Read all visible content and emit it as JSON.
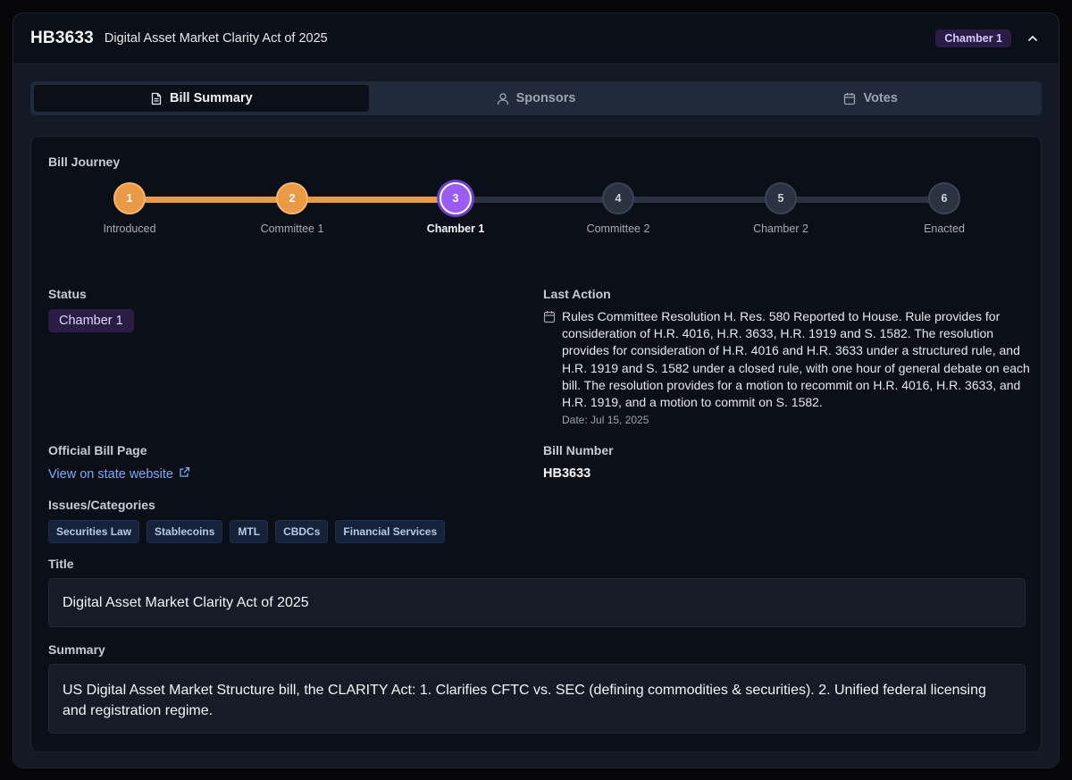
{
  "header": {
    "bill_id": "HB3633",
    "title": "Digital Asset Market Clarity Act of 2025",
    "badge": "Chamber 1"
  },
  "tabs": [
    {
      "label": "Bill Summary",
      "icon": "document-icon",
      "active": true
    },
    {
      "label": "Sponsors",
      "icon": "user-icon",
      "active": false
    },
    {
      "label": "Votes",
      "icon": "calendar-icon",
      "active": false
    }
  ],
  "journey": {
    "label": "Bill Journey",
    "current_step": 3,
    "steps": [
      {
        "number": "1",
        "label": "Introduced",
        "state": "done"
      },
      {
        "number": "2",
        "label": "Committee 1",
        "state": "done"
      },
      {
        "number": "3",
        "label": "Chamber 1",
        "state": "current"
      },
      {
        "number": "4",
        "label": "Committee 2",
        "state": "todo"
      },
      {
        "number": "5",
        "label": "Chamber 2",
        "state": "todo"
      },
      {
        "number": "6",
        "label": "Enacted",
        "state": "todo"
      }
    ]
  },
  "status": {
    "label": "Status",
    "value": "Chamber 1"
  },
  "last_action": {
    "label": "Last Action",
    "text": "Rules Committee Resolution H. Res. 580 Reported to House. Rule provides for consideration of H.R. 4016, H.R. 3633, H.R. 1919 and S. 1582. The resolution provides for consideration of H.R. 4016 and H.R. 3633 under a structured rule, and H.R. 1919 and S. 1582 under a closed rule, with one hour of general debate on each bill. The resolution provides for a motion to recommit on H.R. 4016, H.R. 3633, and H.R. 1919, and a motion to commit on S. 1582.",
    "date": "Date: Jul 15, 2025"
  },
  "official_page": {
    "label": "Official Bill Page",
    "link_text": "View on state website"
  },
  "bill_number": {
    "label": "Bill Number",
    "value": "HB3633"
  },
  "issues": {
    "label": "Issues/Categories",
    "tags": [
      "Securities Law",
      "Stablecoins",
      "MTL",
      "CBDCs",
      "Financial Services"
    ]
  },
  "title_section": {
    "label": "Title",
    "value": "Digital Asset Market Clarity Act of 2025"
  },
  "summary_section": {
    "label": "Summary",
    "value": "US Digital Asset Market Structure bill, the CLARITY Act: 1. Clarifies CFTC vs. SEC (defining commodities & securities). 2. Unified federal licensing and registration regime."
  },
  "colors": {
    "accent_orange": "#ea9a45",
    "accent_purple": "#9b5cf6",
    "link_blue": "#82a9f5"
  }
}
